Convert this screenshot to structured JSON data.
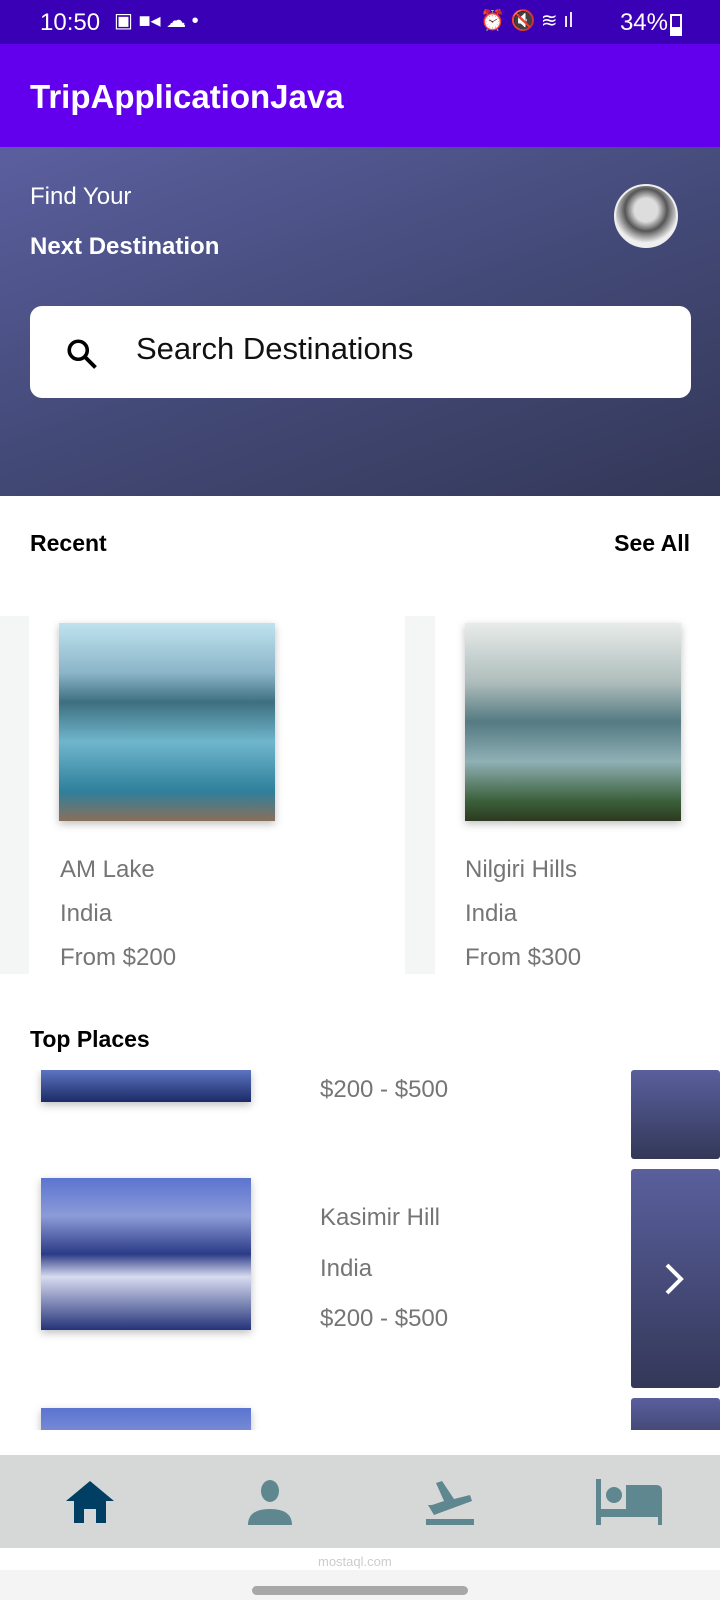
{
  "status_bar": {
    "time": "10:50",
    "battery": "34%"
  },
  "app_bar": {
    "title": "TripApplicationJava"
  },
  "hero": {
    "line1": "Find Your",
    "line2": "Next Destination",
    "search_placeholder": "Search Destinations"
  },
  "recent": {
    "title": "Recent",
    "see_all": "See All",
    "items": [
      {
        "name": "AM Lake",
        "country": "India",
        "price": "From $200"
      },
      {
        "name": "Nilgiri Hills",
        "country": "India",
        "price": "From $300"
      }
    ]
  },
  "top_places": {
    "title": "Top Places",
    "items": [
      {
        "price": "$200 - $500"
      },
      {
        "name": "Kasimir Hill",
        "country": "India",
        "price": "$200 - $500"
      }
    ]
  },
  "bottom_nav": {
    "items": [
      "home-icon",
      "person-icon",
      "flight-departure-icon",
      "hotel-bed-icon"
    ],
    "active": "home-icon",
    "active_color": "#003f63",
    "inactive_color": "#5f8790"
  },
  "watermark": "mostaql.com"
}
